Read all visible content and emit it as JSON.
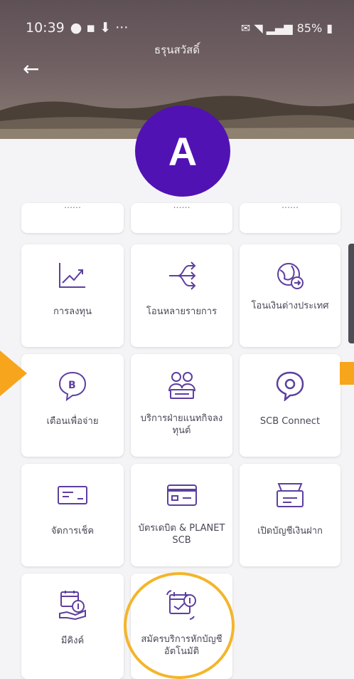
{
  "status_bar": {
    "time": "10:39",
    "battery": "85%"
  },
  "header": {
    "title": "ธรุนสวัสดิ์"
  },
  "badge": {
    "letter": "A"
  },
  "colors": {
    "accent": "#5112b4",
    "highlight": "#f4b52a",
    "arrow": "#f7a51c",
    "icon_stroke": "#5d3fa0"
  },
  "menu": {
    "items": [
      {
        "label": "การลงทุน",
        "icon": "line-chart-icon"
      },
      {
        "label": "โอนหลายรายการ",
        "icon": "multi-transfer-icon"
      },
      {
        "label": "โอนเงินต่างประเทศ",
        "icon": "globe-transfer-icon"
      },
      {
        "label": "เตือนเพื่อจ่าย",
        "icon": "bill-reminder-icon"
      },
      {
        "label": "บริการฝ่ายแนทกิจลงทุนต์",
        "icon": "people-service-icon"
      },
      {
        "label": "SCB Connect",
        "icon": "chat-icon"
      },
      {
        "label": "จัดการเช็ค",
        "icon": "cheque-icon"
      },
      {
        "label": "บัตรเดบิต & PLANET SCB",
        "icon": "debit-card-icon"
      },
      {
        "label": "เปิดบัญชีเงินฝาก",
        "icon": "open-account-icon"
      },
      {
        "label": "มีคิงค์",
        "icon": "payment-hand-icon"
      },
      {
        "label": "สมัครบริการหักบัญชีอัตโนมัติ",
        "icon": "auto-debit-icon"
      }
    ]
  }
}
